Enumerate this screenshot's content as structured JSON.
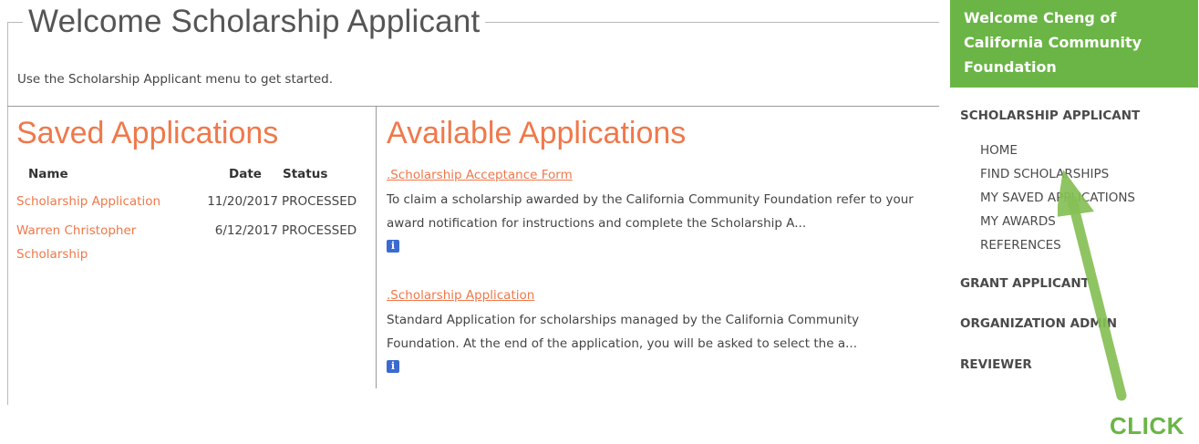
{
  "main": {
    "title": "Welcome Scholarship Applicant",
    "intro": "Use the Scholarship Applicant menu to get started."
  },
  "saved": {
    "title": "Saved Applications",
    "headers": {
      "name": "Name",
      "date": "Date",
      "status": "Status"
    },
    "rows": [
      {
        "name_line1": "Scholarship Application",
        "name_line2": "",
        "date": "11/20/2017",
        "status": "PROCESSED"
      },
      {
        "name_line1": "Warren Christopher",
        "name_line2": "Scholarship",
        "date": "6/12/2017",
        "status": "PROCESSED"
      }
    ]
  },
  "available": {
    "title": "Available Applications",
    "items": [
      {
        "link": ".Scholarship Acceptance Form",
        "desc": "To claim a scholarship awarded by the California Community Foundation refer to your award notification for instructions and complete the Scholarship A..."
      },
      {
        "link": ".Scholarship Application",
        "desc": "Standard Application for scholarships managed by the California Community Foundation. At the end of the application, you will be asked to select the a..."
      }
    ]
  },
  "sidebar": {
    "welcome": "Welcome Cheng of California Community Foundation",
    "sections": [
      "SCHOLARSHIP APPLICANT",
      "GRANT APPLICANT",
      "ORGANIZATION ADMIN",
      "REVIEWER"
    ],
    "scholarship_items": [
      "HOME",
      "FIND SCHOLARSHIPS",
      "MY SAVED APPLICATIONS",
      "MY AWARDS",
      "REFERENCES"
    ]
  },
  "annotation": {
    "label": "CLICK",
    "color": "#6ab546"
  },
  "colors": {
    "accent_orange": "#f0784a",
    "brand_green": "#6ab546",
    "info_blue": "#3b6bd0"
  },
  "icons": {
    "info": "info-icon"
  }
}
